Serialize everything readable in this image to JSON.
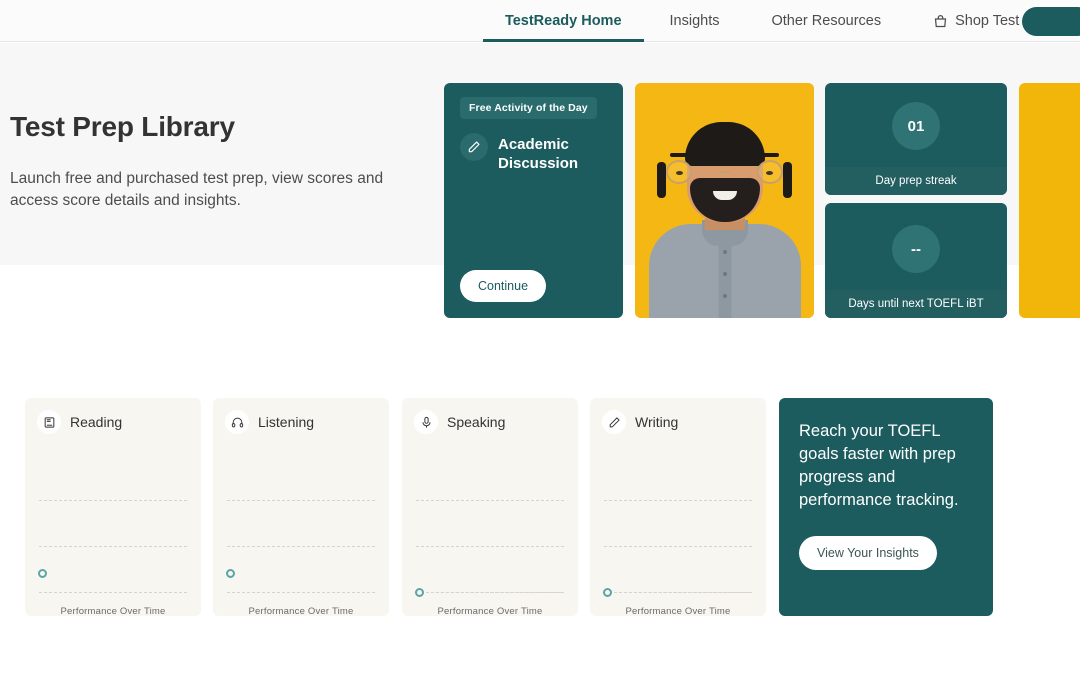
{
  "nav": {
    "items": [
      {
        "label": "TestReady Home",
        "active": true,
        "icon": null
      },
      {
        "label": "Insights",
        "active": false,
        "icon": null
      },
      {
        "label": "Other Resources",
        "active": false,
        "icon": null
      },
      {
        "label": "Shop Test Prep",
        "active": false,
        "icon": "shopping-bag-icon"
      }
    ],
    "account_pill": ""
  },
  "hero": {
    "title": "Test Prep Library",
    "subtitle": "Launch free and purchased test prep, view scores and access score details and insights."
  },
  "activity_card": {
    "badge": "Free Activity of the Day",
    "icon": "pencil-icon",
    "title": "Academic Discussion",
    "button": "Continue"
  },
  "photo_card": {
    "alt": "smiling-man-with-glasses-photo"
  },
  "stats": [
    {
      "value": "01",
      "label": "Day prep streak"
    },
    {
      "value": "--",
      "label": "Days until next TOEFL iBT"
    }
  ],
  "skills": [
    {
      "name": "Reading",
      "icon": "book-icon",
      "caption": "Performance Over Time",
      "marker": "mid"
    },
    {
      "name": "Listening",
      "icon": "headphones-icon",
      "caption": "Performance Over Time",
      "marker": "mid"
    },
    {
      "name": "Speaking",
      "icon": "microphone-icon",
      "caption": "Performance Over Time",
      "marker": "low"
    },
    {
      "name": "Writing",
      "icon": "pencil-icon",
      "caption": "Performance Over Time",
      "marker": "low"
    }
  ],
  "promo": {
    "text": "Reach your TOEFL goals faster with prep progress and performance tracking.",
    "button": "View Your Insights"
  },
  "colors": {
    "teal": "#1c5b5e",
    "teal_light": "#2f7375",
    "yellow": "#F2B50A",
    "marker_ring": "#5aa6a5",
    "card_cream": "#f8f6f1",
    "hero_bg": "#f7f7f7"
  }
}
